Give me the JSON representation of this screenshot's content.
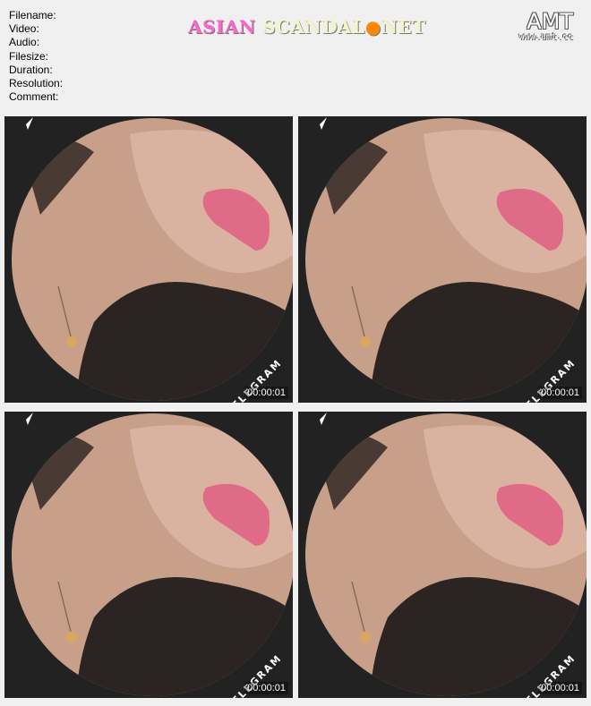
{
  "meta": {
    "filename_label": "Filename:",
    "video_label": "Video:",
    "audio_label": "Audio:",
    "filesize_label": "Filesize:",
    "duration_label": "Duration:",
    "resolution_label": "Resolution:",
    "comment_label": "Comment:"
  },
  "logo": {
    "part1": "ASIAN",
    "part2": "SCANDAL",
    "dot": "●",
    "part3": "NET"
  },
  "amt": {
    "big": "AMT",
    "small": "www.amt.cc"
  },
  "thumbnails": [
    {
      "watermark": "TELEGRAM",
      "timestamp": "00:00:01"
    },
    {
      "watermark": "TELEGRAM",
      "timestamp": "00:00:01"
    },
    {
      "watermark": "TELEGRAM",
      "timestamp": "00:00:01"
    },
    {
      "watermark": "TELEGRAM",
      "timestamp": "00:00:01"
    }
  ],
  "colors": {
    "background": "#f0f0f0",
    "frame": "#222222",
    "skin": "#c8a08a",
    "hair": "#2b2422",
    "lips": "#e06b86",
    "logo_pink": "#ff66cc",
    "logo_cream": "#f4f4c8"
  }
}
